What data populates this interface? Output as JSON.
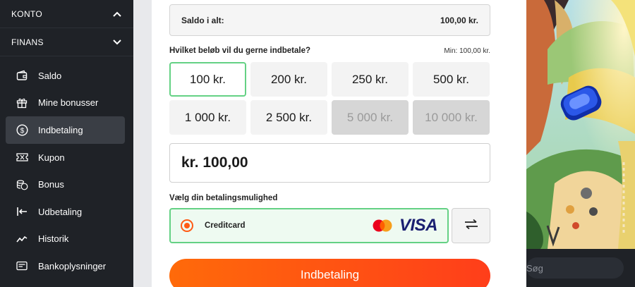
{
  "sidebar": {
    "sections": [
      {
        "label": "KONTO",
        "chevron": "chevron-up-icon"
      },
      {
        "label": "FINANS",
        "chevron": "chevron-down-icon"
      }
    ],
    "items": [
      {
        "label": "Saldo",
        "icon": "wallet-icon"
      },
      {
        "label": "Mine bonusser",
        "icon": "gift-icon"
      },
      {
        "label": "Indbetaling",
        "icon": "dollar-circle-icon",
        "active": true
      },
      {
        "label": "Kupon",
        "icon": "ticket-icon"
      },
      {
        "label": "Bonus",
        "icon": "coins-icon"
      },
      {
        "label": "Udbetaling",
        "icon": "withdraw-icon"
      },
      {
        "label": "Historik",
        "icon": "chart-line-icon"
      },
      {
        "label": "Bankoplysninger",
        "icon": "card-icon"
      }
    ]
  },
  "balance": {
    "label": "Saldo i alt:",
    "value": "100,00 kr."
  },
  "deposit": {
    "question": "Hvilket beløb vil du gerne indbetale?",
    "min": "Min: 100,00 kr.",
    "amounts": [
      {
        "label": "100 kr.",
        "state": "selected"
      },
      {
        "label": "200 kr.",
        "state": "normal"
      },
      {
        "label": "250 kr.",
        "state": "normal"
      },
      {
        "label": "500 kr.",
        "state": "normal"
      },
      {
        "label": "1 000 kr.",
        "state": "normal"
      },
      {
        "label": "2 500 kr.",
        "state": "normal"
      },
      {
        "label": "5 000 kr.",
        "state": "disabled"
      },
      {
        "label": "10 000 kr.",
        "state": "disabled"
      }
    ],
    "input_value": "kr. 100,00"
  },
  "payment": {
    "label": "Vælg din betalingsmulighed",
    "method": "Creditcard",
    "brand_visa": "VISA",
    "swap_icon": "swap-arrows-icon"
  },
  "submit_label": "Indbetaling",
  "search": {
    "placeholder": "Søg"
  },
  "colors": {
    "accent_green": "#64d184",
    "accent_orange": "#ff5a14",
    "sidebar_bg": "#1f2227"
  }
}
